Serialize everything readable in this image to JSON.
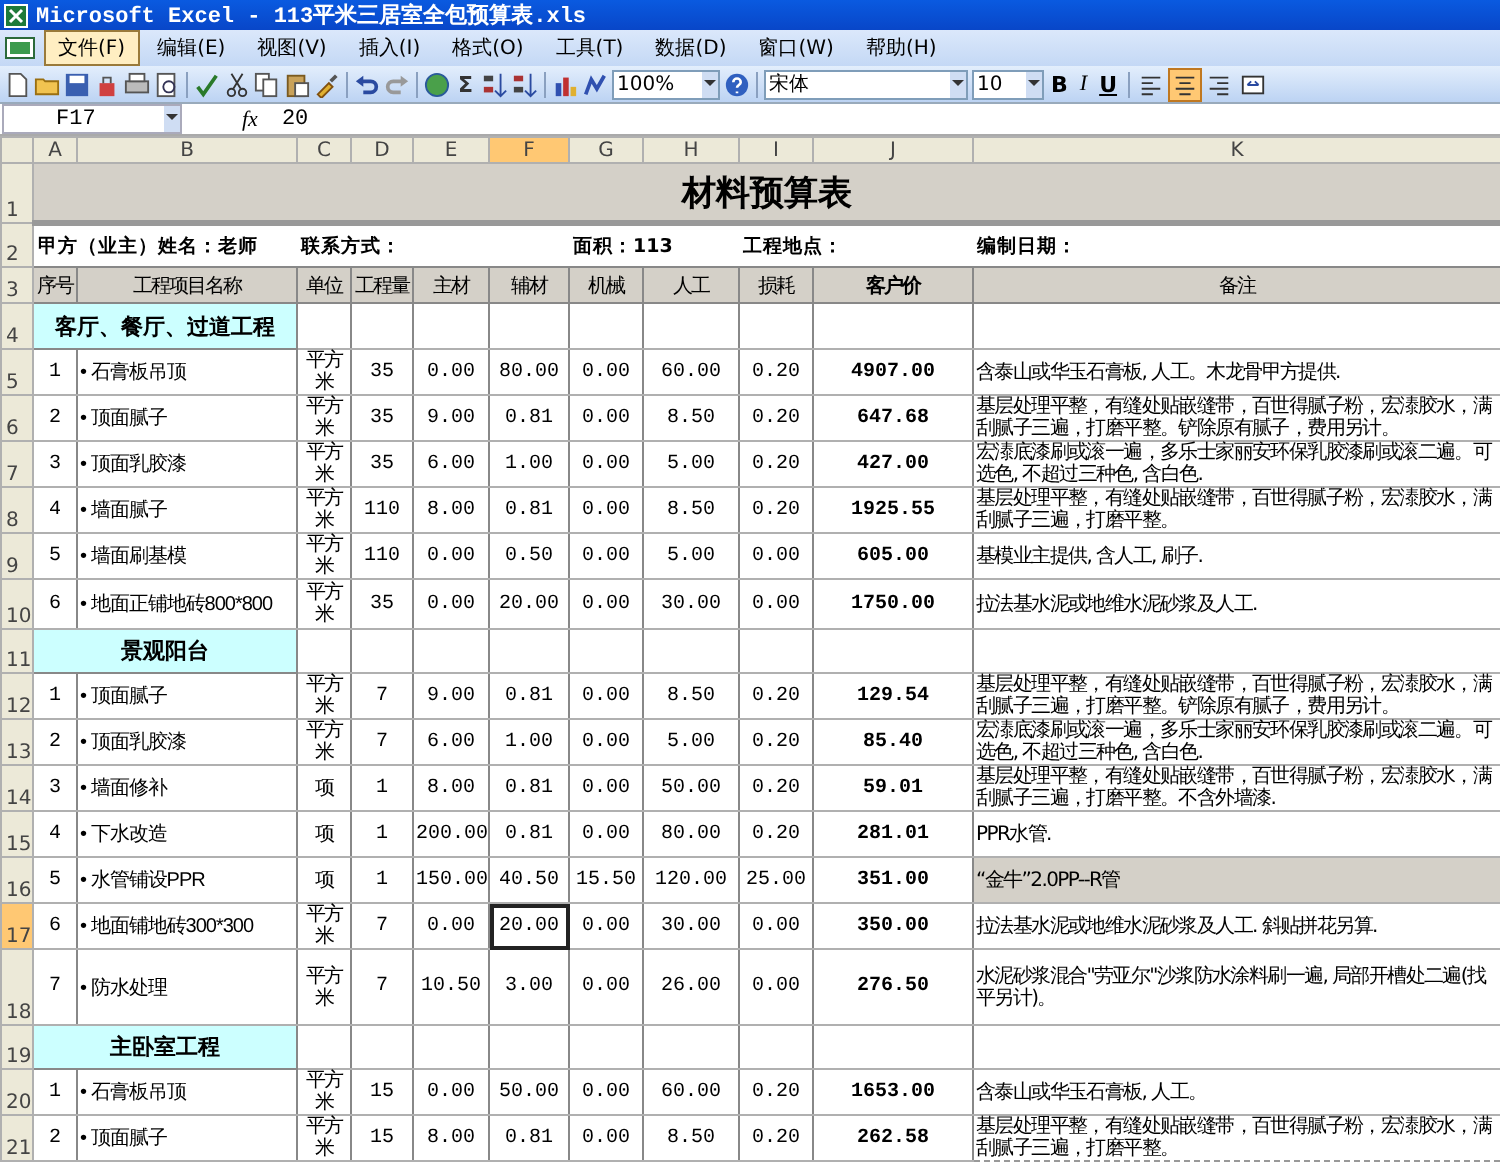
{
  "window": {
    "title": "Microsoft Excel - 113平米三居室全包预算表.xls"
  },
  "menu": [
    {
      "label": "文件(F)",
      "selected": true
    },
    {
      "label": "编辑(E)",
      "selected": false
    },
    {
      "label": "视图(V)",
      "selected": false
    },
    {
      "label": "插入(I)",
      "selected": false
    },
    {
      "label": "格式(O)",
      "selected": false
    },
    {
      "label": "工具(T)",
      "selected": false
    },
    {
      "label": "数据(D)",
      "selected": false
    },
    {
      "label": "窗口(W)",
      "selected": false
    },
    {
      "label": "帮助(H)",
      "selected": false
    }
  ],
  "toolbar": {
    "sum": "Σ",
    "zoom": "100%",
    "font": "宋体",
    "size": "10",
    "bold": "B",
    "italic": "I",
    "underline": "U",
    "align": [
      {
        "kind": "left",
        "selected": false
      },
      {
        "kind": "center",
        "selected": true
      },
      {
        "kind": "right",
        "selected": false
      },
      {
        "kind": "merge",
        "selected": false
      }
    ]
  },
  "formula_bar": {
    "cell": "F17",
    "fx": "fx",
    "value": "20"
  },
  "columns": [
    {
      "label": "A",
      "selected": false
    },
    {
      "label": "B",
      "selected": false
    },
    {
      "label": "C",
      "selected": false
    },
    {
      "label": "D",
      "selected": false
    },
    {
      "label": "E",
      "selected": false
    },
    {
      "label": "F",
      "selected": true
    },
    {
      "label": "G",
      "selected": false
    },
    {
      "label": "H",
      "selected": false
    },
    {
      "label": "I",
      "selected": false
    },
    {
      "label": "J",
      "selected": false
    },
    {
      "label": "K",
      "selected": false
    }
  ],
  "row_numbers": [
    {
      "label": "1",
      "selected": false
    },
    {
      "label": "2",
      "selected": false
    },
    {
      "label": "3",
      "selected": false
    },
    {
      "label": "4",
      "selected": false
    },
    {
      "label": "5",
      "selected": false
    },
    {
      "label": "6",
      "selected": false
    },
    {
      "label": "7",
      "selected": false
    },
    {
      "label": "8",
      "selected": false
    },
    {
      "label": "9",
      "selected": false
    },
    {
      "label": "10",
      "selected": false
    },
    {
      "label": "11",
      "selected": false
    },
    {
      "label": "12",
      "selected": false
    },
    {
      "label": "13",
      "selected": false
    },
    {
      "label": "14",
      "selected": false
    },
    {
      "label": "15",
      "selected": false
    },
    {
      "label": "16",
      "selected": false
    },
    {
      "label": "17",
      "selected": true
    },
    {
      "label": "18",
      "selected": false
    },
    {
      "label": "19",
      "selected": false
    },
    {
      "label": "20",
      "selected": false
    },
    {
      "label": "21",
      "selected": false
    }
  ],
  "sheet": {
    "title": "材料预算表",
    "info": {
      "client": "甲方（业主）姓名：老师",
      "contact": "联系方式：",
      "area": "面积：113",
      "site": "工程地点：",
      "date": "编制日期："
    },
    "headers": [
      "序号",
      "工程项目名称",
      "单位",
      "工程量",
      "主材",
      "辅材",
      "机械",
      "人工",
      "损耗",
      "客户价",
      "备注"
    ],
    "sections": [
      {
        "title": "客厅、餐厅、过道工程",
        "items": [
          {
            "no": "1",
            "name": "• 石膏板吊顶",
            "unit": "平方米",
            "qty": "35",
            "main": "0.00",
            "aux": "80.00",
            "machine": "0.00",
            "labor": "60.00",
            "loss": "0.20",
            "price": "4907.00",
            "note": "含泰山或华玉石膏板, 人工。木龙骨甲方提供.",
            "aux_selected": false,
            "note_highlighted": false
          },
          {
            "no": "2",
            "name": "• 顶面腻子",
            "unit": "平方米",
            "qty": "35",
            "main": "9.00",
            "aux": "0.81",
            "machine": "0.00",
            "labor": "8.50",
            "loss": "0.20",
            "price": "647.68",
            "note": "基层处理平整，有缝处贴嵌缝带，百世得腻子粉，宏溙胶水，满刮腻子三遍，打磨平整。铲除原有腻子，费用另计。",
            "aux_selected": false,
            "note_highlighted": false
          },
          {
            "no": "3",
            "name": "• 顶面乳胶漆",
            "unit": "平方米",
            "qty": "35",
            "main": "6.00",
            "aux": "1.00",
            "machine": "0.00",
            "labor": "5.00",
            "loss": "0.20",
            "price": "427.00",
            "note": "宏溙底漆刷或滚一遍，多乐士家丽安环保乳胶漆刷或滚二遍。可选色, 不超过三种色, 含白色.",
            "aux_selected": false,
            "note_highlighted": false
          },
          {
            "no": "4",
            "name": "• 墙面腻子",
            "unit": "平方米",
            "qty": "110",
            "main": "8.00",
            "aux": "0.81",
            "machine": "0.00",
            "labor": "8.50",
            "loss": "0.20",
            "price": "1925.55",
            "note": "基层处理平整，有缝处贴嵌缝带，百世得腻子粉，宏溙胶水，满刮腻子三遍，打磨平整。",
            "aux_selected": false,
            "note_highlighted": false
          },
          {
            "no": "5",
            "name": "• 墙面刷基模",
            "unit": "平方米",
            "qty": "110",
            "main": "0.00",
            "aux": "0.50",
            "machine": "0.00",
            "labor": "5.00",
            "loss": "0.00",
            "price": "605.00",
            "note": "基模业主提供, 含人工, 刷子.",
            "aux_selected": false,
            "note_highlighted": false
          },
          {
            "no": "6",
            "name": "• 地面正铺地砖800*800",
            "unit": "平方米",
            "qty": "35",
            "main": "0.00",
            "aux": "20.00",
            "machine": "0.00",
            "labor": "30.00",
            "loss": "0.00",
            "price": "1750.00",
            "note": "拉法基水泥或地维水泥砂浆及人工.",
            "aux_selected": false,
            "note_highlighted": false
          }
        ]
      },
      {
        "title": "景观阳台",
        "items": [
          {
            "no": "1",
            "name": "• 顶面腻子",
            "unit": "平方米",
            "qty": "7",
            "main": "9.00",
            "aux": "0.81",
            "machine": "0.00",
            "labor": "8.50",
            "loss": "0.20",
            "price": "129.54",
            "note": "基层处理平整，有缝处贴嵌缝带，百世得腻子粉，宏溙胶水，满刮腻子三遍，打磨平整。铲除原有腻子，费用另计。",
            "aux_selected": false,
            "note_highlighted": false
          },
          {
            "no": "2",
            "name": "• 顶面乳胶漆",
            "unit": "平方米",
            "qty": "7",
            "main": "6.00",
            "aux": "1.00",
            "machine": "0.00",
            "labor": "5.00",
            "loss": "0.20",
            "price": "85.40",
            "note": "宏溙底漆刷或滚一遍，多乐士家丽安环保乳胶漆刷或滚二遍。可选色, 不超过三种色, 含白色.",
            "aux_selected": false,
            "note_highlighted": false
          },
          {
            "no": "3",
            "name": "• 墙面修补",
            "unit": "项",
            "qty": "1",
            "main": "8.00",
            "aux": "0.81",
            "machine": "0.00",
            "labor": "50.00",
            "loss": "0.20",
            "price": "59.01",
            "note": "基层处理平整，有缝处贴嵌缝带，百世得腻子粉，宏溙胶水，满刮腻子三遍，打磨平整。不含外墙漆.",
            "aux_selected": false,
            "note_highlighted": false
          },
          {
            "no": "4",
            "name": "• 下水改造",
            "unit": "项",
            "qty": "1",
            "main": "200.00",
            "aux": "0.81",
            "machine": "0.00",
            "labor": "80.00",
            "loss": "0.20",
            "price": "281.01",
            "note": "PPR水管.",
            "aux_selected": false,
            "note_highlighted": false
          },
          {
            "no": "5",
            "name": "• 水管铺设PPR",
            "unit": "项",
            "qty": "1",
            "main": "150.00",
            "aux": "40.50",
            "machine": "15.50",
            "labor": "120.00",
            "loss": "25.00",
            "price": "351.00",
            "note": "“金牛”2.0PP--R管",
            "aux_selected": false,
            "note_highlighted": true
          },
          {
            "no": "6",
            "name": "• 地面铺地砖300*300",
            "unit": "平方米",
            "qty": "7",
            "main": "0.00",
            "aux": "20.00",
            "machine": "0.00",
            "labor": "30.00",
            "loss": "0.00",
            "price": "350.00",
            "note": "拉法基水泥或地维水泥砂浆及人工. 斜贴拼花另算.",
            "aux_selected": true,
            "note_highlighted": false
          },
          {
            "no": "7",
            "name": "• 防水处理",
            "unit": "平方米",
            "qty": "7",
            "main": "10.50",
            "aux": "3.00",
            "machine": "0.00",
            "labor": "26.00",
            "loss": "0.00",
            "price": "276.50",
            "note": "水泥砂浆混合\"劳亚尔\"沙浆防水涂料刷一遍, 局部开槽处二遍(找平另计)。",
            "aux_selected": false,
            "note_highlighted": false
          }
        ]
      },
      {
        "title": "主卧室工程",
        "items": [
          {
            "no": "1",
            "name": "• 石膏板吊顶",
            "unit": "平方米",
            "qty": "15",
            "main": "0.00",
            "aux": "50.00",
            "machine": "0.00",
            "labor": "60.00",
            "loss": "0.20",
            "price": "1653.00",
            "note": "含泰山或华玉石膏板, 人工。",
            "aux_selected": false,
            "note_highlighted": false
          },
          {
            "no": "2",
            "name": "• 顶面腻子",
            "unit": "平方米",
            "qty": "15",
            "main": "8.00",
            "aux": "0.81",
            "machine": "0.00",
            "labor": "8.50",
            "loss": "0.20",
            "price": "262.58",
            "note": "基层处理平整，有缝处贴嵌缝带，百世得腻子粉，宏溙胶水，满刮腻子三遍，打磨平整。",
            "aux_selected": false,
            "note_highlighted": false
          }
        ]
      }
    ]
  }
}
